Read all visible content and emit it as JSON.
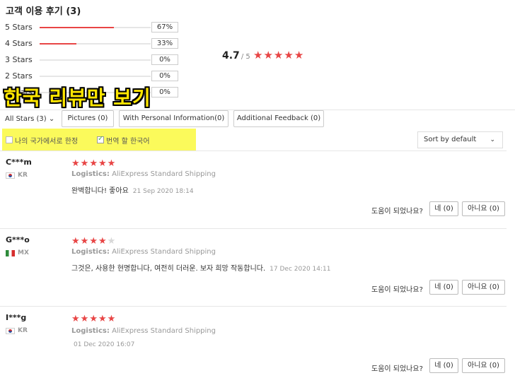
{
  "title": "고객 이용 후기 (3)",
  "star_breakdown": [
    {
      "label": "5 Stars",
      "percent_text": "67%",
      "fraction": 0.67
    },
    {
      "label": "4 Stars",
      "percent_text": "33%",
      "fraction": 0.33
    },
    {
      "label": "3 Stars",
      "percent_text": "0%",
      "fraction": 0
    },
    {
      "label": "2 Stars",
      "percent_text": "0%",
      "fraction": 0
    },
    {
      "label": "1 Stars",
      "percent_text": "0%",
      "fraction": 0
    }
  ],
  "summary": {
    "score": "4.7",
    "out_of": "/ 5",
    "rating": 4.7
  },
  "banner": "한국 리뷰만 보기",
  "filters": {
    "all_stars": "All Stars (3)",
    "pictures": "Pictures (0)",
    "personal_info": "With Personal Information(0)",
    "additional": "Additional Feedback (0)"
  },
  "options": {
    "my_country": "나의 국가에서로 한정",
    "translate": "번역 할 한국어"
  },
  "sort": {
    "value": "Sort by default"
  },
  "reviews": [
    {
      "user": "C***m",
      "country": "KR",
      "stars": 5,
      "logistics_label": "Logistics:",
      "logistics": "AliExpress Standard Shipping",
      "text": "완벽합니다! 좋아요",
      "date": "21 Sep 2020 18:14",
      "helpful": "도움이 되었나요?",
      "yes": "네 (0)",
      "no": "아니요 (0)"
    },
    {
      "user": "G***o",
      "country": "MX",
      "stars": 4,
      "logistics_label": "Logistics:",
      "logistics": "AliExpress Standard Shipping",
      "text": "그것은, 사용한 현명합니다, 여전히 더러운. 보자 희망 작동합니다.",
      "date": "17 Dec 2020 14:11",
      "helpful": "도움이 되었나요?",
      "yes": "네 (0)",
      "no": "아니요 (0)"
    },
    {
      "user": "I***g",
      "country": "KR",
      "stars": 5,
      "logistics_label": "Logistics:",
      "logistics": "AliExpress Standard Shipping",
      "text": "",
      "date": "01 Dec 2020 16:07",
      "helpful": "도움이 되었나요?",
      "yes": "네 (0)",
      "no": "아니요 (0)"
    }
  ],
  "colors": {
    "accent": "#e84545",
    "highlight": "#fbfa5b",
    "banner": "#ffe600"
  }
}
